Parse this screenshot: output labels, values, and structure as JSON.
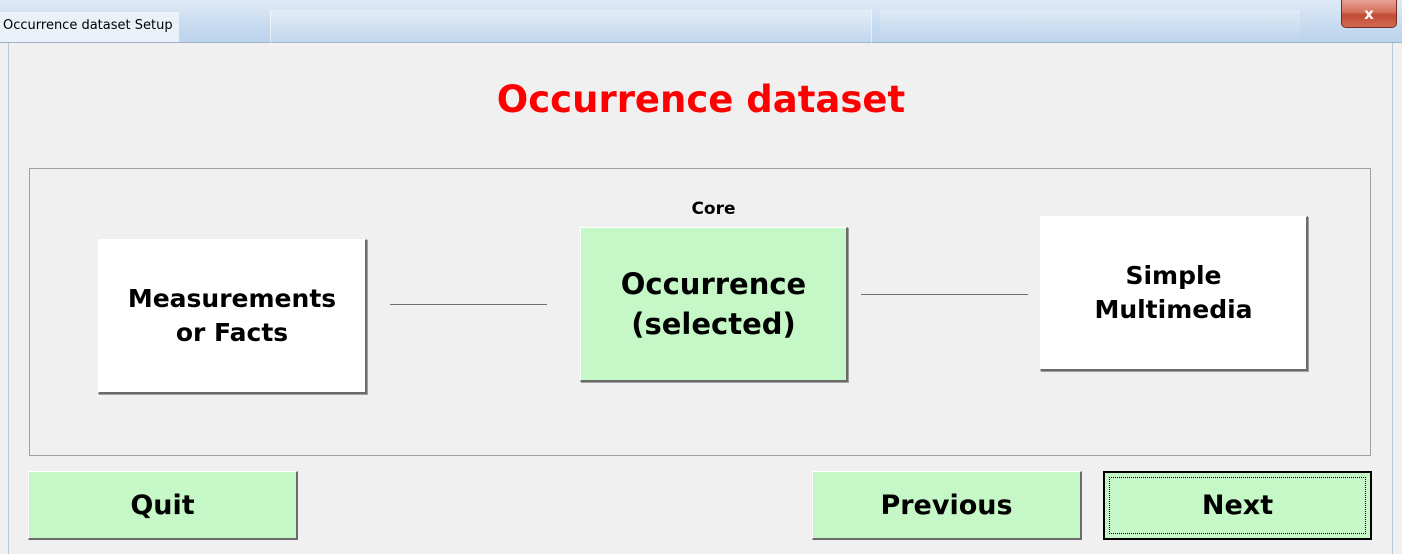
{
  "window": {
    "title": "Occurrence dataset Setup",
    "close_label": "x"
  },
  "header": {
    "title": "Occurrence dataset",
    "title_color": "#ff0000"
  },
  "diagram": {
    "core_label": "Core",
    "boxes": {
      "left": {
        "label": "Measurements\nor Facts",
        "background": "#ffffff"
      },
      "center": {
        "label": "Occurrence\n(selected)",
        "background": "#c6f7c6"
      },
      "right": {
        "label": "Simple\nMultimedia",
        "background": "#ffffff"
      }
    }
  },
  "buttons": {
    "quit_label": "Quit",
    "previous_label": "Previous",
    "next_label": "Next",
    "background": "#c6f7c6"
  },
  "icons": {
    "close": "close-icon"
  }
}
